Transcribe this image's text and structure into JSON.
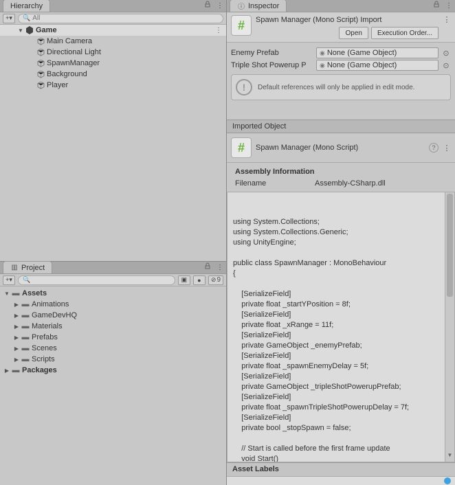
{
  "hierarchy": {
    "tab_label": "Hierarchy",
    "search_placeholder": "All",
    "root": "Game",
    "items": [
      "Main Camera",
      "Directional Light",
      "SpawnManager",
      "Background",
      "Player"
    ]
  },
  "project": {
    "tab_label": "Project",
    "hidden_count": "9",
    "assets_label": "Assets",
    "folders": [
      "Animations",
      "GameDevHQ",
      "Materials",
      "Prefabs",
      "Scenes",
      "Scripts"
    ],
    "packages_label": "Packages"
  },
  "inspector": {
    "tab_label": "Inspector",
    "script_name": "Spawn Manager (Mono Script) Import",
    "open_btn": "Open",
    "exec_order_btn": "Execution Order...",
    "props": [
      {
        "label": "Enemy Prefab",
        "value": "None (Game Object)"
      },
      {
        "label": "Triple Shot Powerup P",
        "value": "None (Game Object)"
      }
    ],
    "info_text": "Default references will only be applied in edit mode.",
    "imported_header": "Imported Object",
    "imported_name": "Spawn Manager (Mono Script)",
    "assembly_header": "Assembly Information",
    "assembly_file_label": "Filename",
    "assembly_file_value": "Assembly-CSharp.dll",
    "code": "using System.Collections;\nusing System.Collections.Generic;\nusing UnityEngine;\n\npublic class SpawnManager : MonoBehaviour\n{\n\n    [SerializeField]\n    private float _startYPosition = 8f;\n    [SerializeField]\n    private float _xRange = 11f;\n    [SerializeField]\n    private GameObject _enemyPrefab;\n    [SerializeField]\n    private float _spawnEnemyDelay = 5f;\n    [SerializeField]\n    private GameObject _tripleShotPowerupPrefab;\n    [SerializeField]\n    private float _spawnTripleShotPowerupDelay = 7f;\n    [SerializeField]\n    private bool _stopSpawn = false;\n\n    // Start is called before the first frame update\n    void Start()",
    "asset_labels_header": "Asset Labels"
  }
}
